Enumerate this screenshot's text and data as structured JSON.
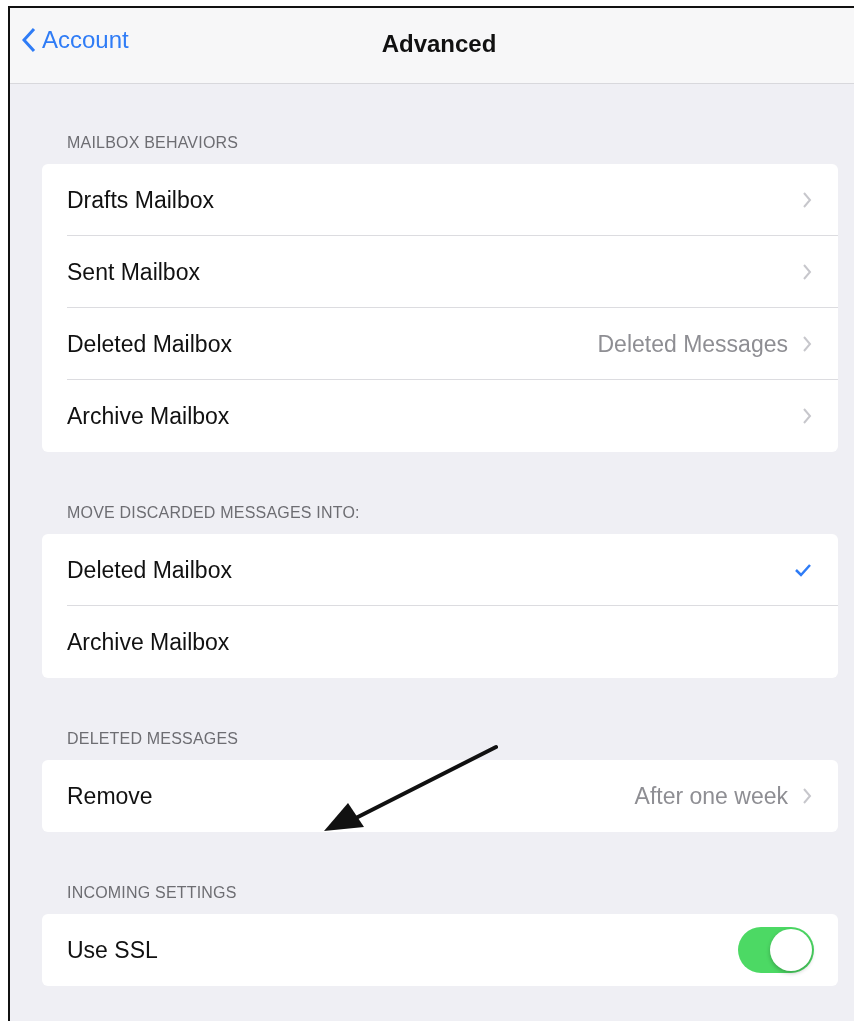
{
  "nav": {
    "back": "Account",
    "title": "Advanced"
  },
  "sections": [
    {
      "header": "MAILBOX BEHAVIORS",
      "rows": [
        {
          "kind": "disclosure",
          "label": "Drafts Mailbox"
        },
        {
          "kind": "disclosure",
          "label": "Sent Mailbox"
        },
        {
          "kind": "disclosure",
          "label": "Deleted Mailbox",
          "value": "Deleted Messages"
        },
        {
          "kind": "disclosure",
          "label": "Archive Mailbox"
        }
      ]
    },
    {
      "header": "MOVE DISCARDED MESSAGES INTO:",
      "rows": [
        {
          "kind": "check",
          "label": "Deleted Mailbox",
          "selected": true
        },
        {
          "kind": "check",
          "label": "Archive Mailbox",
          "selected": false
        }
      ]
    },
    {
      "header": "DELETED MESSAGES",
      "rows": [
        {
          "kind": "disclosure",
          "label": "Remove",
          "value": "After one week"
        }
      ]
    },
    {
      "header": "INCOMING SETTINGS",
      "rows": [
        {
          "kind": "toggle",
          "label": "Use SSL",
          "on": true
        }
      ]
    }
  ]
}
